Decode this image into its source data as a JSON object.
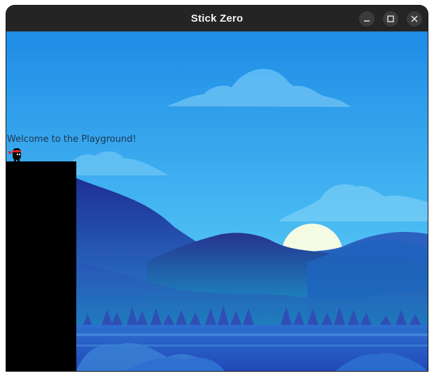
{
  "window": {
    "title": "Stick Zero",
    "controls": {
      "minimize_icon": "minimize-icon",
      "maximize_icon": "maximize-icon",
      "close_icon": "close-icon"
    }
  },
  "game": {
    "welcome_text": "Welcome to the Playground!",
    "player": {
      "character": "ninja",
      "headband_color": "#e0242b",
      "body_color": "#0b0b0b"
    },
    "platform": {
      "color": "#000000"
    },
    "background": {
      "theme": "mountain-lake-sunset",
      "sky_top": "#1e8fe8",
      "sky_bottom": "#6fd6f8",
      "sun_color": "#f4fbe4"
    }
  }
}
